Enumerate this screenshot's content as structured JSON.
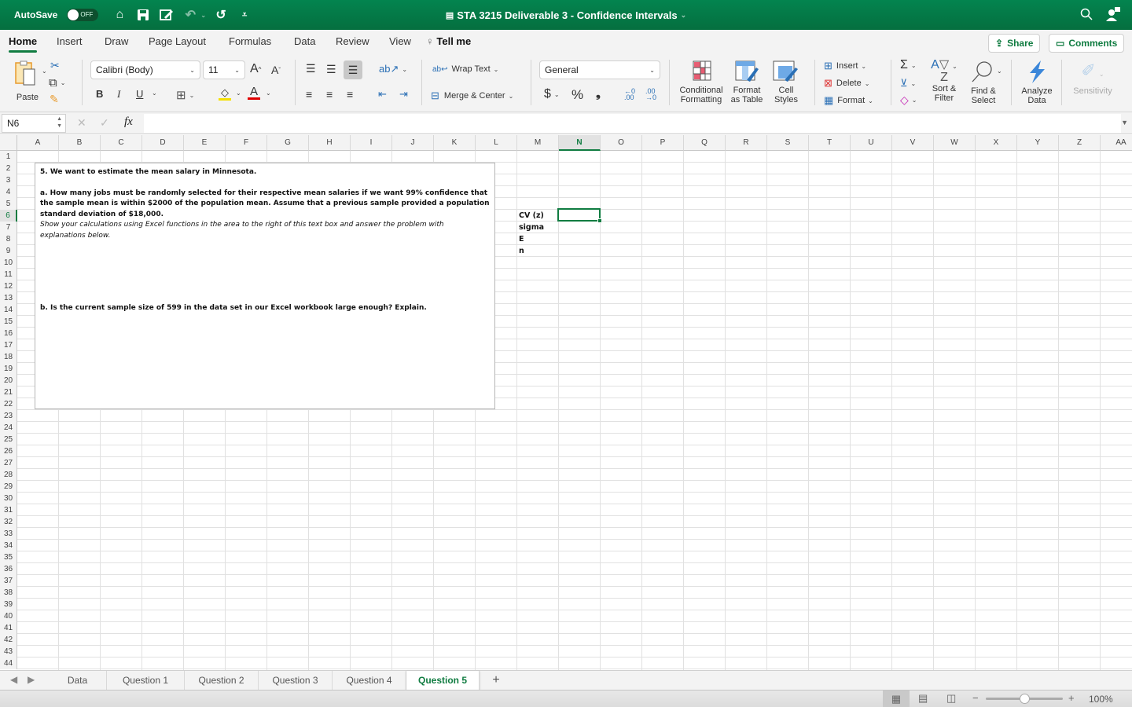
{
  "titlebar": {
    "autosave_label": "AutoSave",
    "autosave_state": "OFF",
    "document_title": "STA 3215 Deliverable 3 - Confidence Intervals",
    "quick_access": [
      "home-icon",
      "save-icon",
      "edit-icon",
      "undo-icon",
      "redo-icon",
      "customize-icon"
    ]
  },
  "menu": {
    "tabs": [
      "Home",
      "Insert",
      "Draw",
      "Page Layout",
      "Formulas",
      "Data",
      "Review",
      "View"
    ],
    "active_tab": "Home",
    "tell_me": "Tell me",
    "share_label": "Share",
    "comments_label": "Comments"
  },
  "ribbon": {
    "paste_label": "Paste",
    "font_name": "Calibri (Body)",
    "font_size": "11",
    "bold": "B",
    "italic": "I",
    "underline": "U",
    "wrap_text": "Wrap Text",
    "merge_center": "Merge & Center",
    "number_format": "General",
    "currency": "$",
    "percent": "%",
    "comma": "9",
    "conditional_formatting": [
      "Conditional",
      "Formatting"
    ],
    "format_as_table": [
      "Format",
      "as Table"
    ],
    "cell_styles": [
      "Cell",
      "Styles"
    ],
    "insert": "Insert",
    "delete": "Delete",
    "format": "Format",
    "sort_filter": [
      "Sort &",
      "Filter"
    ],
    "find_select": [
      "Find &",
      "Select"
    ],
    "analyze_data": [
      "Analyze",
      "Data"
    ],
    "sensitivity": "Sensitivity",
    "colors": {
      "highlight": "#f5e000",
      "font_color": "#e00000",
      "accent": "#107c41"
    }
  },
  "formula_bar": {
    "name_box": "N6",
    "fx": "fx",
    "formula": ""
  },
  "grid": {
    "columns": [
      "A",
      "B",
      "C",
      "D",
      "E",
      "F",
      "G",
      "H",
      "I",
      "J",
      "K",
      "L",
      "M",
      "N",
      "O",
      "P",
      "Q",
      "R",
      "S",
      "T",
      "U",
      "V",
      "W",
      "X",
      "Y",
      "Z",
      "AA"
    ],
    "selected_column": "N",
    "selected_row": 6,
    "row_count": 44,
    "cells": [
      {
        "ref": "M6",
        "value": "CV (z)"
      },
      {
        "ref": "M7",
        "value": "sigma"
      },
      {
        "ref": "M8",
        "value": "E"
      },
      {
        "ref": "M9",
        "value": "n"
      }
    ]
  },
  "textbox": {
    "heading": "5. We want to estimate the mean salary in Minnesota.",
    "part_a": "a. How many jobs must be randomly selected for their respective mean salaries if we want 99% confidence that the sample mean is within $2000 of the population mean. Assume that a previous sample provided a population standard deviation of $18,000.",
    "instruction": "Show your calculations using Excel functions in the area to the right of this text box and answer the problem with explanations below.",
    "part_b": "b. Is the current sample size of 599 in the data set in our Excel workbook large enough? Explain."
  },
  "sheets": {
    "tabs": [
      "Data",
      "Question 1",
      "Question 2",
      "Question 3",
      "Question 4",
      "Question 5"
    ],
    "active": "Question 5",
    "add_label": "+"
  },
  "status": {
    "zoom": "100%",
    "zoom_minus": "−",
    "zoom_plus": "+",
    "zoom_fraction": 0.5
  }
}
